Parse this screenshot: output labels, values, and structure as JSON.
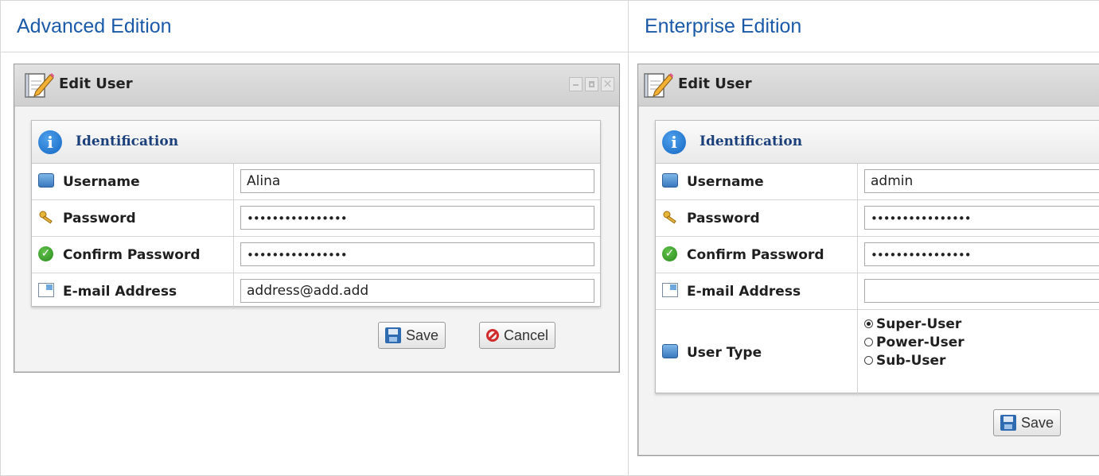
{
  "columns": [
    {
      "edition_title": "Advanced Edition",
      "window": {
        "title": "Edit User",
        "section_title": "Identification",
        "fields": [
          {
            "label": "Username",
            "value": "Alina"
          },
          {
            "label": "Password",
            "value": "••••••••••••••••"
          },
          {
            "label": "Confirm Password",
            "value": "••••••••••••••••"
          },
          {
            "label": "E-mail Address",
            "value": "address@add.add"
          }
        ],
        "save_label": "Save",
        "cancel_label": "Cancel"
      }
    },
    {
      "edition_title": "Enterprise Edition",
      "window": {
        "title": "Edit User",
        "section_title": "Identification",
        "fields": [
          {
            "label": "Username",
            "value": "admin"
          },
          {
            "label": "Password",
            "value": "••••••••••••••••"
          },
          {
            "label": "Confirm Password",
            "value": "••••••••••••••••"
          },
          {
            "label": "E-mail Address",
            "value": ""
          }
        ],
        "user_type": {
          "label": "User Type",
          "options": [
            "Super-User",
            "Power-User",
            "Sub-User"
          ],
          "selected": "Super-User"
        },
        "save_label": "Save"
      }
    }
  ]
}
